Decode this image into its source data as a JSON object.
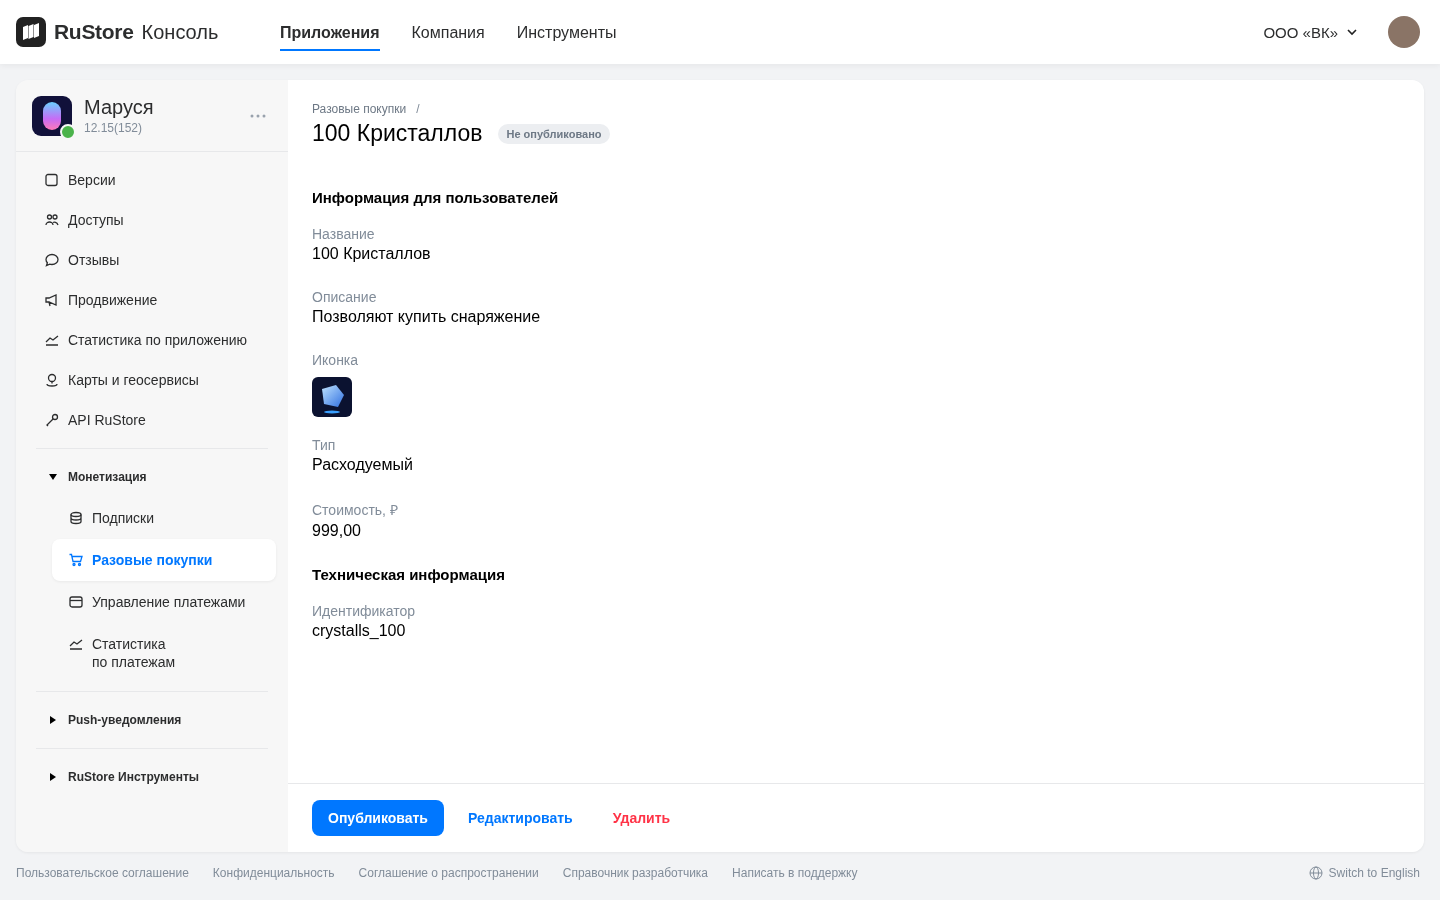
{
  "header": {
    "logo": "RuStore",
    "subtitle": "Консоль",
    "nav": [
      {
        "label": "Приложения",
        "selected": true
      },
      {
        "label": "Компания",
        "selected": false
      },
      {
        "label": "Инструменты",
        "selected": false
      }
    ],
    "org": "ООО «ВК»"
  },
  "app": {
    "name": "Маруся",
    "version": "12.15(152)",
    "online": true
  },
  "sidebar": {
    "items": [
      {
        "label": "Версии"
      },
      {
        "label": "Доступы"
      },
      {
        "label": "Отзывы"
      },
      {
        "label": "Продвижение"
      },
      {
        "label": "Статистика по приложению"
      },
      {
        "label": "Карты и геосервисы"
      },
      {
        "label": "API RuStore"
      }
    ],
    "groups": [
      {
        "label": "Монетизация",
        "expanded": true,
        "children": [
          {
            "label": "Подписки",
            "selected": false
          },
          {
            "label": "Разовые покупки",
            "selected": true
          },
          {
            "label": "Управление платежами",
            "selected": false
          },
          {
            "label": "Статистика\nпо платежам",
            "selected": false
          }
        ]
      },
      {
        "label": "Push-уведомления",
        "expanded": false
      },
      {
        "label": "RuStore Инструменты",
        "expanded": false
      }
    ]
  },
  "breadcrumb": "Разовые покупки",
  "separator": "/",
  "title": "100 Кристаллов",
  "status": "Не опубликовано",
  "sections": [
    {
      "title": "Информация для пользователей",
      "fields": [
        {
          "kind": "text",
          "label": "Название",
          "value": "100 Кристаллов"
        },
        {
          "kind": "text",
          "label": "Описание",
          "value": "Позволяют купить снаряжение"
        },
        {
          "kind": "image",
          "label": "Иконка"
        },
        {
          "kind": "text",
          "label": "Тип",
          "value": "Расходуемый"
        },
        {
          "kind": "text",
          "label": "Стоимость, ₽",
          "value": "999,00"
        }
      ]
    },
    {
      "title": "Техническая информация",
      "fields": [
        {
          "kind": "text",
          "label": "Идентификатор",
          "value": "crystalls_100"
        }
      ]
    }
  ],
  "actions": [
    {
      "kind": "primary",
      "label": "Опубликовать"
    },
    {
      "kind": "link",
      "label": "Редактировать"
    },
    {
      "kind": "danger",
      "label": "Удалить"
    }
  ],
  "footer": {
    "links": [
      "Пользовательское соглашение",
      "Конфиденциальность",
      "Соглашение о распространении",
      "Справочник разработчика",
      "Написать в поддержку"
    ],
    "language": "Switch to English"
  }
}
